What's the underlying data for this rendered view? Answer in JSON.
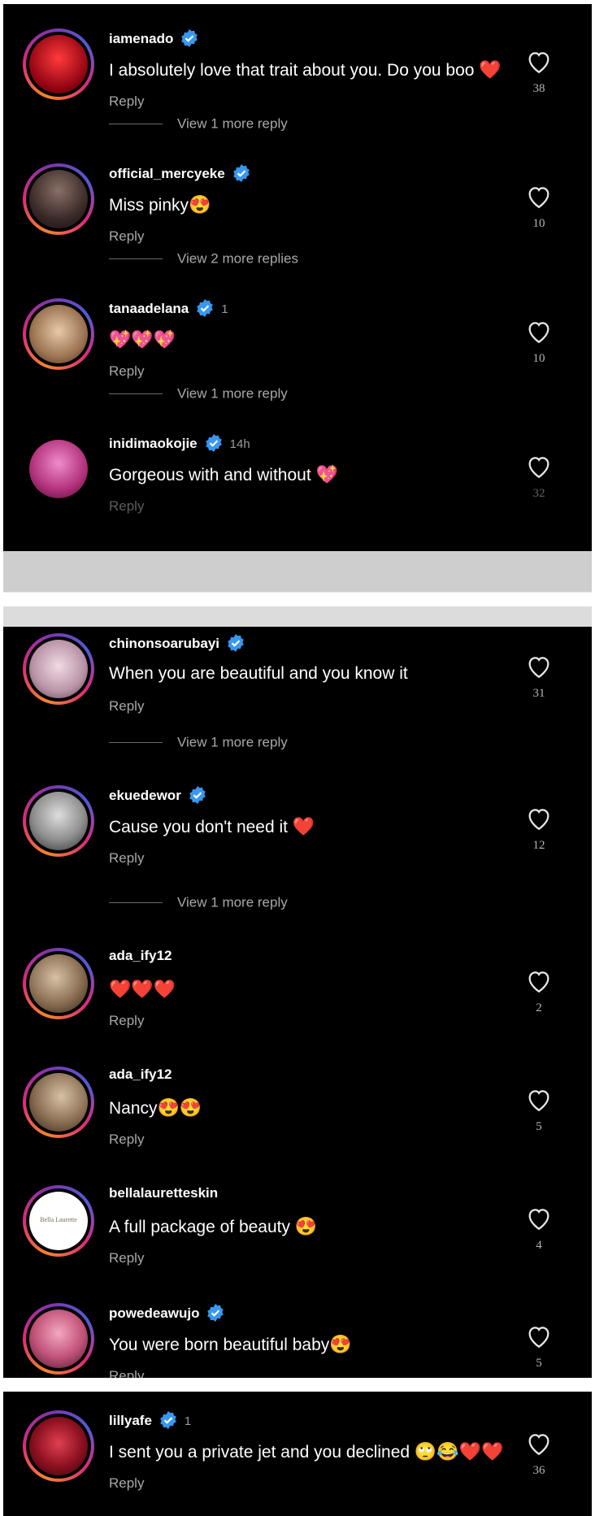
{
  "reply_label": "Reply",
  "comments": [
    {
      "username": "iamenado",
      "verified": true,
      "text": "I absolutely love that trait about you. Do you boo",
      "emoji": "❤️",
      "likes": "38",
      "avatar_color": "#c0101a"
    },
    {
      "username": "official_mercyeke",
      "verified": true,
      "text": "Miss pinky",
      "emoji": "😍",
      "likes": "10",
      "avatar_color": "#5a4a48"
    },
    {
      "username": "tanaadelana",
      "verified": true,
      "text": "",
      "emoji": "💖💖💖",
      "likes": "10",
      "meta": "1",
      "avatar_color": "#c9a27a"
    },
    {
      "username": "inidimaokojie",
      "verified": true,
      "text": "Gorgeous with and without",
      "emoji": "💖",
      "likes": "32",
      "meta": "14h",
      "avatar_color": "#d44aa0"
    },
    {
      "username": "chinonsoarubayi",
      "verified": true,
      "text": "When you are beautiful and you know it",
      "emoji": "",
      "likes": "31",
      "avatar_color": "#d8b7c8"
    },
    {
      "username": "ekuedewor",
      "verified": true,
      "text": "Cause you don't need it",
      "emoji": "❤️",
      "likes": "12",
      "avatar_color": "#9a9a9a"
    },
    {
      "username": "ada_ify12",
      "verified": false,
      "text": "",
      "emoji": "❤️❤️❤️",
      "likes": "2",
      "avatar_color": "#b8a080"
    },
    {
      "username": "ada_ify12",
      "verified": false,
      "text": "Nancy",
      "emoji": "😍😍",
      "likes": "5",
      "avatar_color": "#b8a080"
    },
    {
      "username": "bellalauretteskin",
      "verified": false,
      "text": "A full package of beauty",
      "emoji": "😍",
      "likes": "4",
      "avatar_color": "#ffffff",
      "avatar_text": "Bella Laurette"
    },
    {
      "username": "powedeawujo",
      "verified": true,
      "text": "You were born beautiful baby",
      "emoji": "😍",
      "likes": "5",
      "avatar_color": "#e07a9a"
    },
    {
      "username": "lillyafe",
      "verified": true,
      "text": "I sent you a private jet and you declined",
      "emoji": "🙄😂❤️❤️",
      "likes": "36",
      "meta": "1",
      "avatar_color": "#b01c2a"
    }
  ],
  "view_more": [
    "View 1 more reply",
    "View 2 more replies",
    "View 1 more reply",
    "View 1 more reply",
    "View 1 more reply"
  ],
  "colors": {
    "background": "#000000",
    "verified_badge": "#3897f0",
    "secondary_text": "#a8a8a8"
  }
}
